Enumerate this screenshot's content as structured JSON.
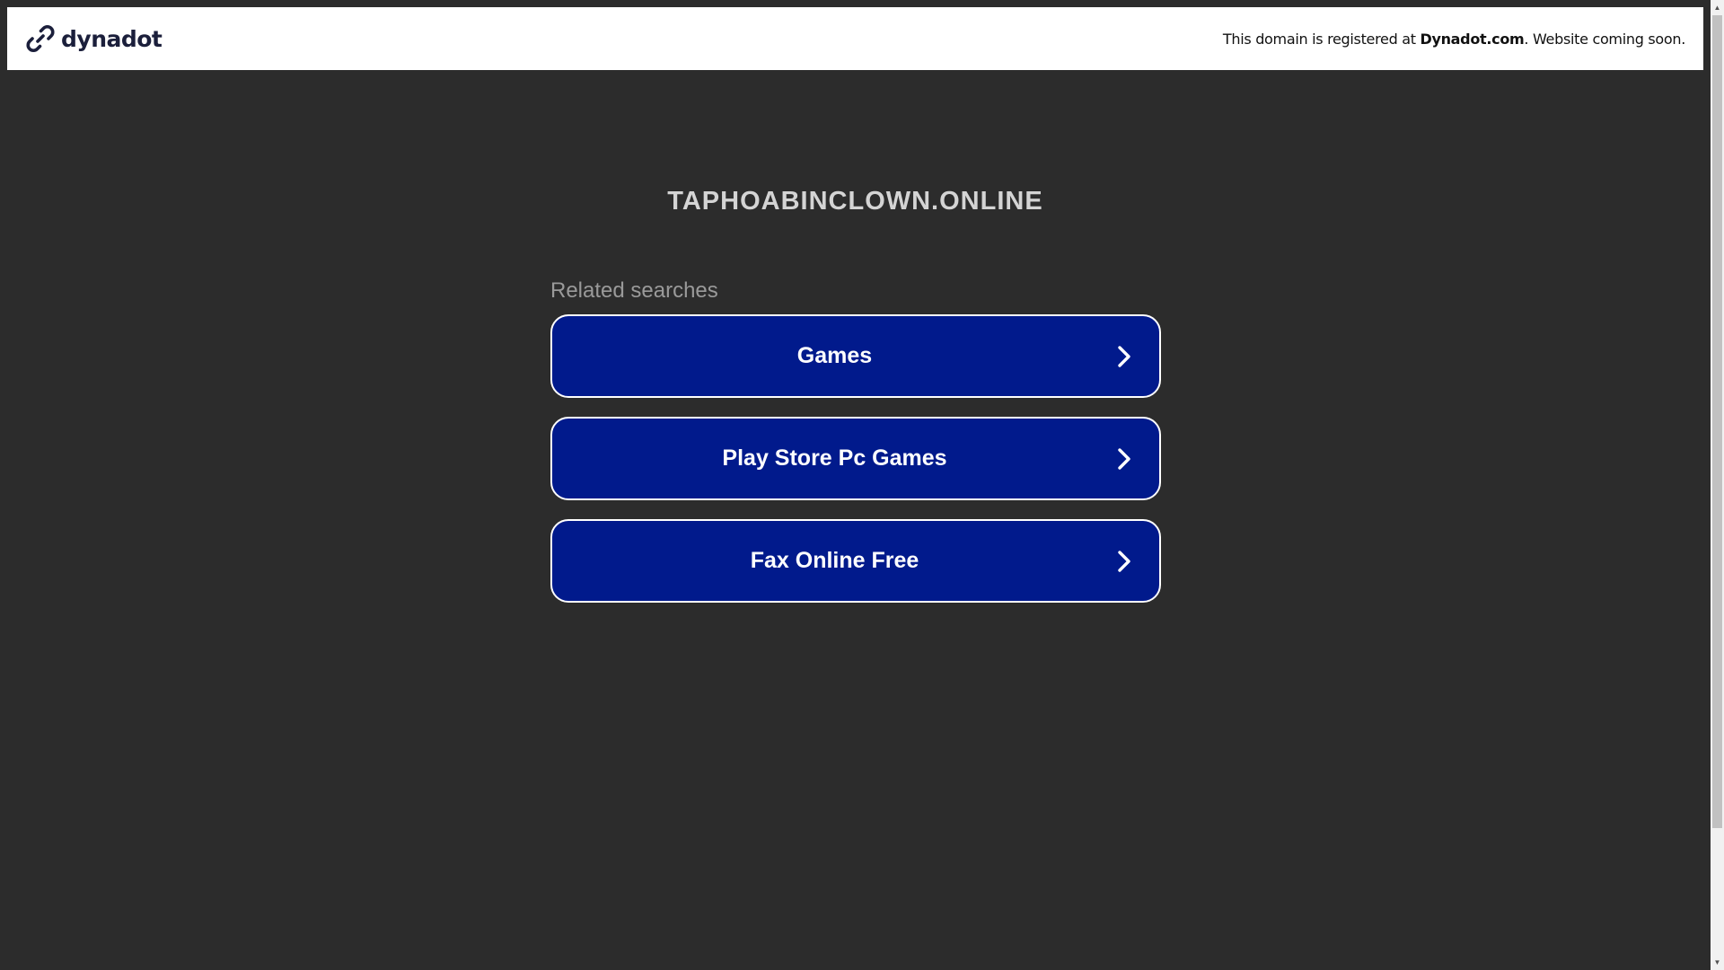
{
  "banner": {
    "logo_text": "dynadot",
    "notice_prefix": "This domain is registered at ",
    "notice_brand": "Dynadot.com",
    "notice_suffix": ". Website coming soon."
  },
  "main": {
    "domain": "TAPHOABINCLOWN.ONLINE",
    "related_heading": "Related searches",
    "results": [
      {
        "label": "Games"
      },
      {
        "label": "Play Store Pc Games"
      },
      {
        "label": "Fax Online Free"
      }
    ]
  },
  "colors": {
    "background": "#2c2c2c",
    "button": "#011a8c",
    "banner": "#ffffff"
  },
  "icons": {
    "logo": "dynadot-link-icon",
    "result_arrow": "chevron-right-icon"
  }
}
